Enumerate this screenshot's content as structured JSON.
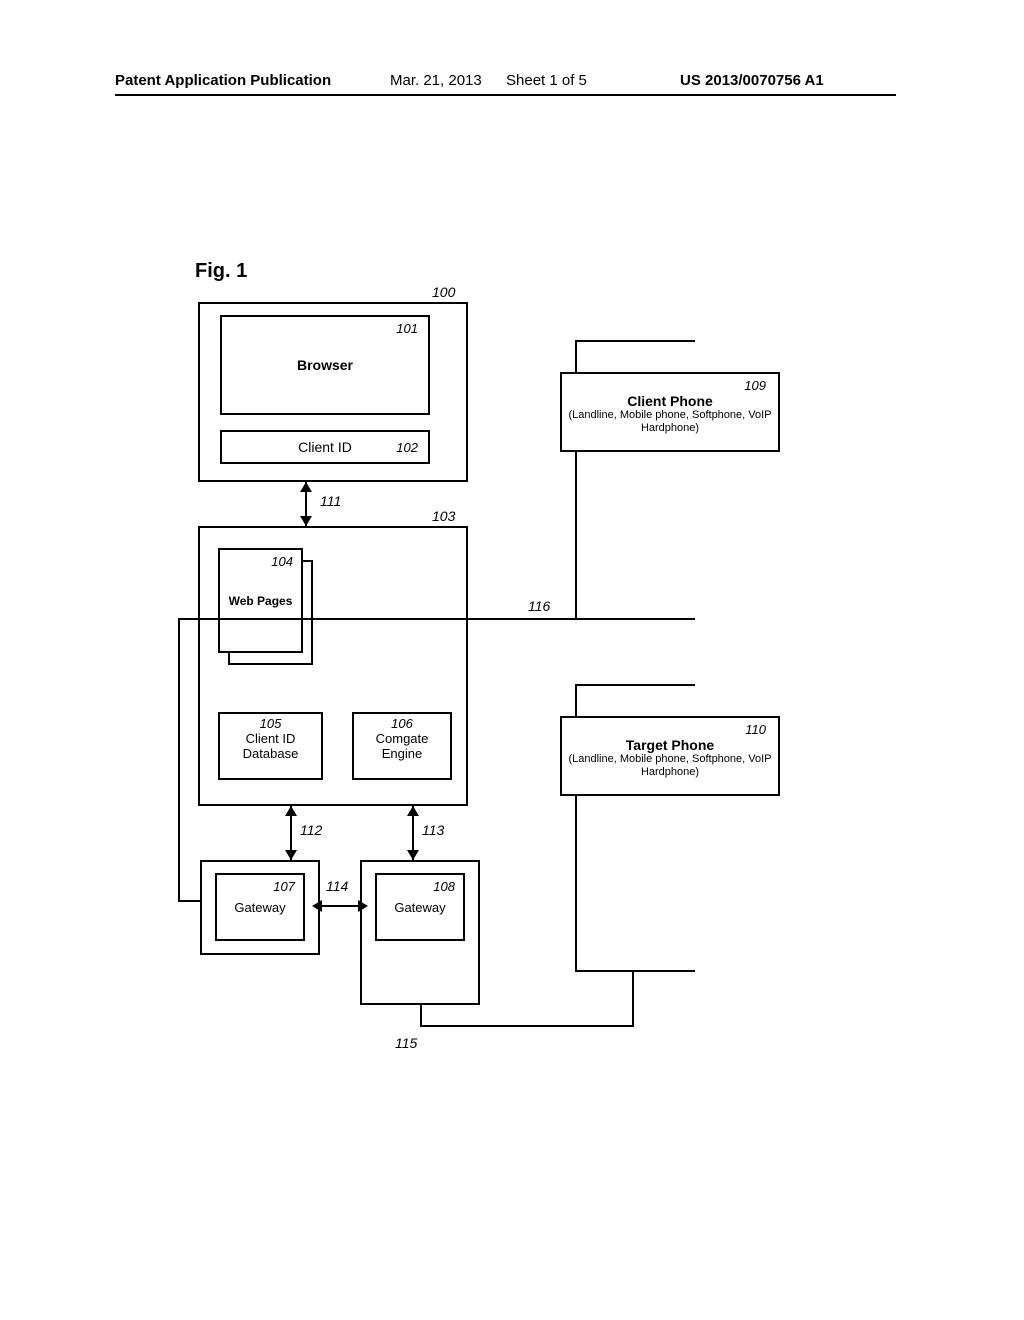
{
  "header": {
    "pub_label": "Patent Application Publication",
    "date": "Mar. 21, 2013",
    "sheet": "Sheet 1 of 5",
    "pubno": "US 2013/0070756 A1"
  },
  "figure_label": "Fig. 1",
  "refs": {
    "n100": "100",
    "n101": "101",
    "n102": "102",
    "n103": "103",
    "n104": "104",
    "n105": "105",
    "n106": "106",
    "n107": "107",
    "n108": "108",
    "n109": "109",
    "n110": "110",
    "n111": "111",
    "n112": "112",
    "n113": "113",
    "n114": "114",
    "n115": "115",
    "n116": "116"
  },
  "boxes": {
    "browser": "Browser",
    "client_id": "Client ID",
    "web_pages": "Web Pages",
    "client_id_db_l1": "Client ID",
    "client_id_db_l2": "Database",
    "comgate_l1": "Comgate",
    "comgate_l2": "Engine",
    "gateway_a": "Gateway",
    "gateway_b": "Gateway",
    "client_phone_title": "Client Phone",
    "client_phone_sub": "(Landline, Mobile phone, Softphone, VoIP Hardphone)",
    "target_phone_title": "Target Phone",
    "target_phone_sub": "(Landline, Mobile phone, Softphone, VoIP Hardphone)"
  }
}
